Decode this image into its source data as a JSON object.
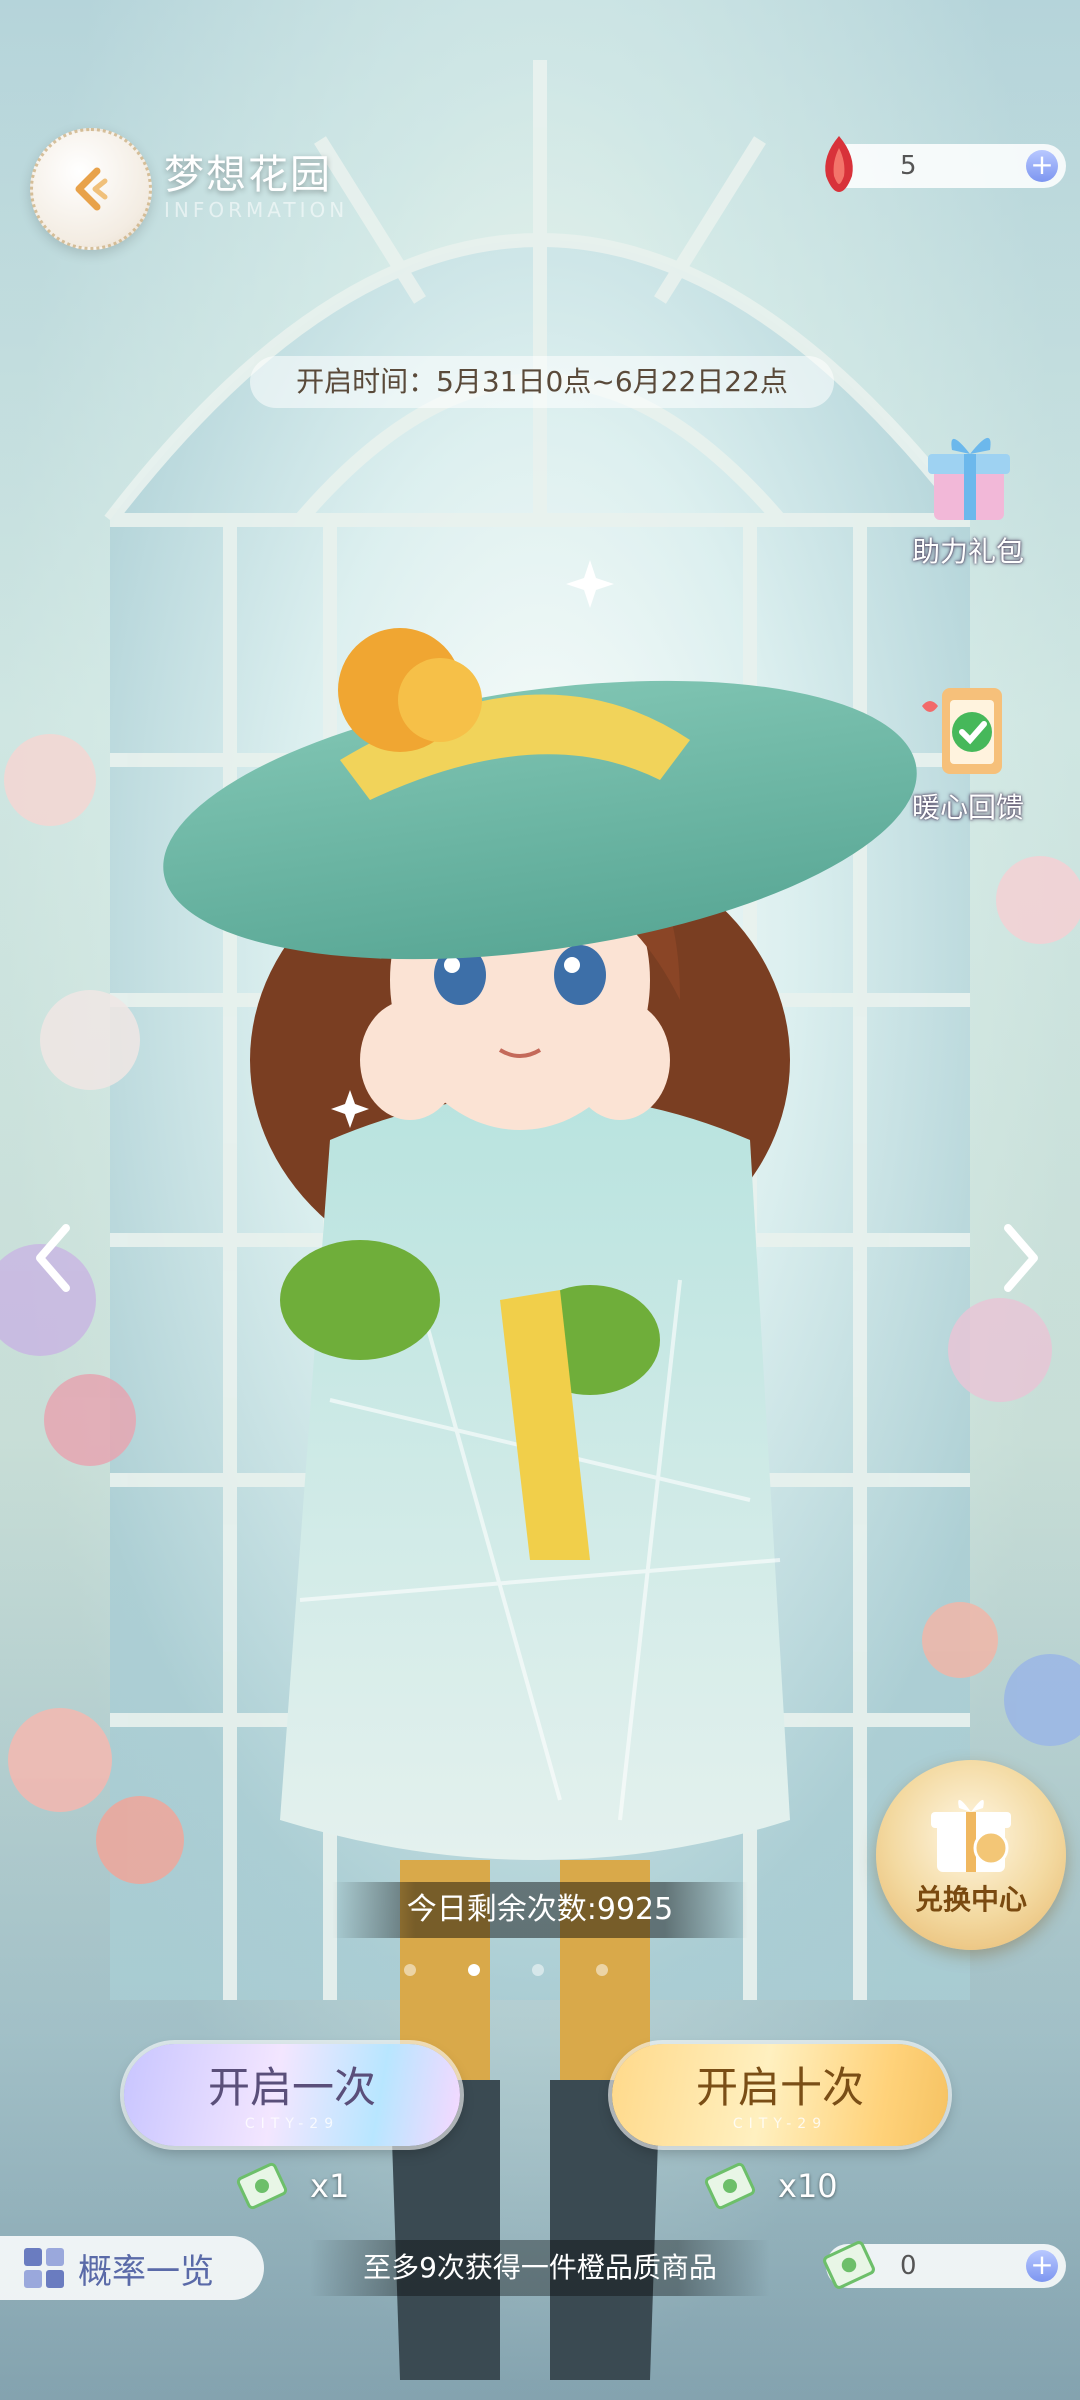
{
  "header": {
    "title": "梦想花园",
    "subtitle": "INFORMATION",
    "back_icon": "back-arrow-icon"
  },
  "currency": {
    "gem_amount": "5",
    "ticket_amount": "0"
  },
  "event": {
    "open_time": "开启时间：5月31日0点~6月22日22点"
  },
  "side_buttons": {
    "gift_pack": "助力礼包",
    "feedback": "暖心回馈",
    "exchange": "兑换中心"
  },
  "remaining": "今日剩余次数:9925",
  "draw": {
    "one_label": "开启一次",
    "ten_label": "开启十次",
    "one_sub": "CITY-29",
    "ten_sub": "CITY-29",
    "one_cost": "x1",
    "ten_cost": "x10"
  },
  "footer": {
    "probability": "概率一览",
    "guarantee": "至多9次获得一件橙品质商品"
  },
  "colors": {
    "accent_purple": "#5a6aa8",
    "gold": "#f5c262"
  }
}
